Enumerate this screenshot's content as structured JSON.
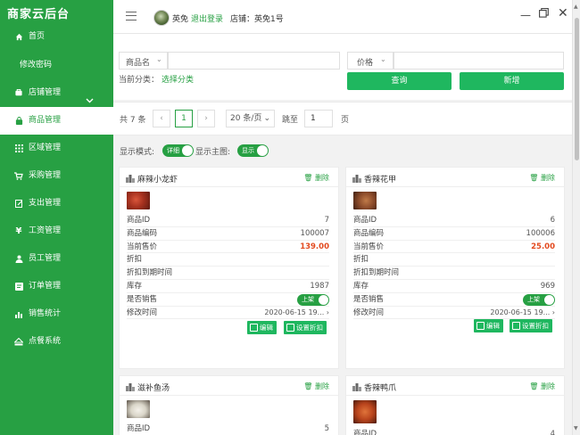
{
  "app": {
    "title": "商家云后台"
  },
  "sidebar": {
    "items": [
      {
        "label": "首页",
        "icon": "home-icon"
      },
      {
        "label": "修改密码",
        "icon": ""
      },
      {
        "label": "店铺管理",
        "icon": "store-icon"
      },
      {
        "label": "商品管理",
        "icon": "bag-icon"
      },
      {
        "label": "区域管理",
        "icon": "grid-icon"
      },
      {
        "label": "采购管理",
        "icon": "cart-icon"
      },
      {
        "label": "支出管理",
        "icon": "edit-icon"
      },
      {
        "label": "工资管理",
        "icon": "yen-icon"
      },
      {
        "label": "员工管理",
        "icon": "user-icon"
      },
      {
        "label": "订单管理",
        "icon": "form-icon"
      },
      {
        "label": "销售统计",
        "icon": "bar-chart-icon"
      },
      {
        "label": "点餐系统",
        "icon": "eject-icon"
      }
    ]
  },
  "topbar": {
    "username": "英免",
    "logout": "退出登录",
    "shop": "店铺：英免1号"
  },
  "search": {
    "field_select": "商品名",
    "price_select": "价格",
    "current_category_label": "当前分类：",
    "choose_category": "选择分类",
    "query_button": "查询",
    "add_button": "新增"
  },
  "pager": {
    "total": "共 7 条",
    "current_page": "1",
    "page_size": "20 条/页",
    "goto_label": "跳至",
    "goto_value": "1",
    "page_suffix": "页"
  },
  "mode": {
    "display_mode_label": "显示模式:",
    "display_mode_value": "详细",
    "show_image_label": "显示主图:",
    "show_image_value": "显示"
  },
  "labels": {
    "delete": "删除",
    "product_id": "商品ID",
    "product_code": "商品编码",
    "current_price": "当前售价",
    "discount": "折扣",
    "discount_expire": "折扣到期时间",
    "stock": "库存",
    "on_sale": "是否销售",
    "modified": "修改时间",
    "on_sale_toggle": "上架",
    "edit": "编辑",
    "set_discount": "设置折扣"
  },
  "products": [
    {
      "name": "麻辣小龙虾",
      "id": "7",
      "code": "100007",
      "price": "139.00",
      "stock": "1987",
      "modified": "2020-06-15 19...",
      "colors": {
        "thumb": "#a5311f"
      }
    },
    {
      "name": "香辣花甲",
      "id": "6",
      "code": "100006",
      "price": "25.00",
      "stock": "969",
      "modified": "2020-06-15 19...",
      "colors": {
        "thumb": "#8a4a2a"
      }
    },
    {
      "name": "滋补鱼汤",
      "id": "5",
      "colors": {
        "thumb": "#d9d5c8"
      }
    },
    {
      "name": "香辣鸭爪",
      "id": "4",
      "colors": {
        "thumb": "#b8431c"
      }
    }
  ],
  "colors": {
    "accent": "#27a043",
    "button": "#1fb75f",
    "price": "#e34a1f"
  }
}
